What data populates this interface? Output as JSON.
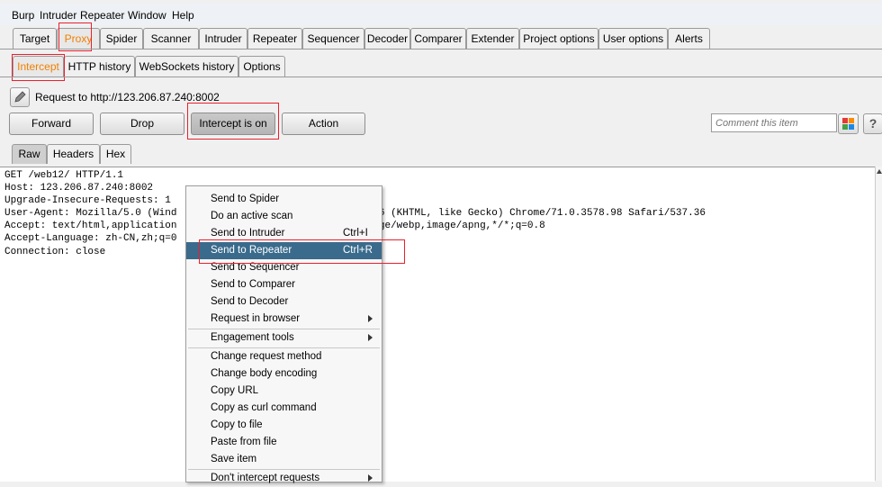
{
  "menubar": {
    "items": [
      "Burp",
      "Intruder",
      "Repeater",
      "Window",
      "Help"
    ]
  },
  "main_tabs": [
    "Target",
    "Proxy",
    "Spider",
    "Scanner",
    "Intruder",
    "Repeater",
    "Sequencer",
    "Decoder",
    "Comparer",
    "Extender",
    "Project options",
    "User options",
    "Alerts"
  ],
  "proxy_tabs": [
    "Intercept",
    "HTTP history",
    "WebSockets history",
    "Options"
  ],
  "request_label": "Request to http://123.206.87.240:8002",
  "buttons": {
    "forward": "Forward",
    "drop": "Drop",
    "intercept": "Intercept is on",
    "action": "Action"
  },
  "comment": {
    "placeholder": "Comment this item"
  },
  "help_label": "?",
  "editor_tabs": [
    "Raw",
    "Headers",
    "Hex"
  ],
  "request_lines": [
    "GET /web12/ HTTP/1.1",
    "Host: 123.206.87.240:8002",
    "Upgrade-Insecure-Requests: 1",
    "User-Agent: Mozilla/5.0 (Wind                             537.36 (KHTML, like Gecko) Chrome/71.0.3578.98 Safari/537.36",
    "Accept: text/html,application                             9,image/webp,image/apng,*/*;q=0.8",
    "Accept-Language: zh-CN,zh;q=0",
    "Connection: close"
  ],
  "context_menu": [
    {
      "label": "Send to Spider",
      "shortcut": "",
      "submenu": false
    },
    {
      "label": "Do an active scan",
      "shortcut": "",
      "submenu": false
    },
    {
      "label": "Send to Intruder",
      "shortcut": "Ctrl+I",
      "submenu": false
    },
    {
      "label": "Send to Repeater",
      "shortcut": "Ctrl+R",
      "submenu": false,
      "highlighted": true
    },
    {
      "label": "Send to Sequencer",
      "shortcut": "",
      "submenu": false
    },
    {
      "label": "Send to Comparer",
      "shortcut": "",
      "submenu": false
    },
    {
      "label": "Send to Decoder",
      "shortcut": "",
      "submenu": false
    },
    {
      "label": "Request in browser",
      "shortcut": "",
      "submenu": true
    },
    {
      "label": "Engagement tools",
      "shortcut": "",
      "submenu": true
    },
    {
      "label": "Change request method",
      "shortcut": "",
      "submenu": false
    },
    {
      "label": "Change body encoding",
      "shortcut": "",
      "submenu": false
    },
    {
      "label": "Copy URL",
      "shortcut": "",
      "submenu": false
    },
    {
      "label": "Copy as curl command",
      "shortcut": "",
      "submenu": false
    },
    {
      "label": "Copy to file",
      "shortcut": "",
      "submenu": false
    },
    {
      "label": "Paste from file",
      "shortcut": "",
      "submenu": false
    },
    {
      "label": "Save item",
      "shortcut": "",
      "submenu": false
    },
    {
      "label": "Don't intercept requests",
      "shortcut": "",
      "submenu": true
    }
  ],
  "colors": {
    "active_tab_text": "#f07f00",
    "menu_highlight": "#3a6b8c",
    "annotation_red": "#e8212f"
  }
}
